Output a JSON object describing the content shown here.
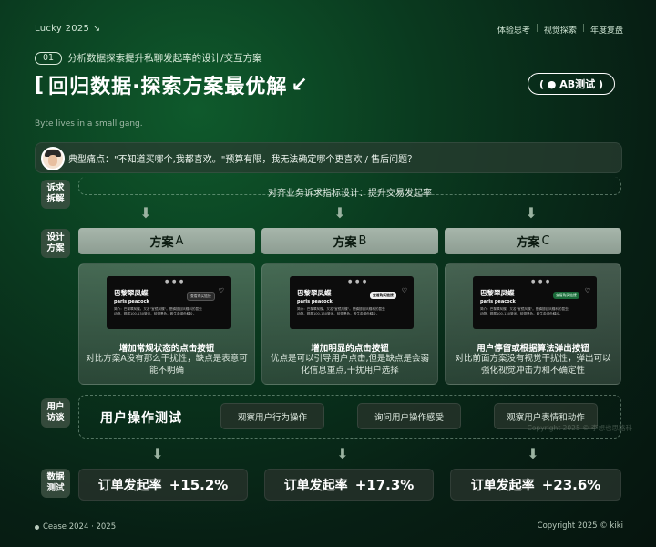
{
  "header": {
    "brand": "Lucky 2025 ↘",
    "nav": [
      "体验思考",
      "视觉探索",
      "年度复盘"
    ],
    "nav_sep": "|",
    "section_num": "01",
    "section_title": "分析数据探索提升私聊发起率的设计/交互方案",
    "title_main": "回归数据·探索方案最优解",
    "title_bracket_open": "[",
    "title_bracket_close": "↙",
    "ab_badge": "( ● AB测试 )",
    "tagline": "Byte lives in a small gang."
  },
  "pain_point": {
    "text": "典型痛点：\"不知道买哪个,我都喜欢。\"预算有限，我无法确定哪个更喜欢 / 售后问题？"
  },
  "rows": {
    "demand": {
      "label": "诉求\n拆解",
      "text": "对齐业务诉求指标设计：提升交易发起率"
    },
    "design": {
      "label": "设计\n方案"
    },
    "interview": {
      "label": "用户\n访谈"
    },
    "data": {
      "label": "数据\n测试"
    }
  },
  "plans": [
    {
      "head_prefix": "方案",
      "head_letter": "A",
      "title": "增加常规状态的点击按钮",
      "desc": "对比方案A没有那么干扰性，缺点是表意可能不明确",
      "mock": {
        "dots": "● ● ●",
        "name": "巴黎翠凤蝶",
        "sub": "paris peacock",
        "desc": "简介：巴黎翠凤蝶。又名\"宝镜凤蝶\"。是鳞翅目凤蝶科的昆虫动物。翅展100-130毫米。前翅黑色。散生金绿色鳞片。",
        "button": "查看购买链接",
        "heart": "♡"
      }
    },
    {
      "head_prefix": "方案",
      "head_letter": "B",
      "title": "增加明显的点击按钮",
      "desc": "优点是可以引导用户点击,但是缺点是会弱化信息重点,干扰用户选择",
      "mock": {
        "dots": "● ● ●",
        "name": "巴黎翠凤蝶",
        "sub": "paris peacock",
        "desc": "简介：巴黎翠凤蝶。又名\"宝镜凤蝶\"。是鳞翅目凤蝶科的昆虫动物。翅展100-130毫米。前翅黑色。散生金绿色鳞片。",
        "button": "查看购买链接",
        "heart": "♡"
      }
    },
    {
      "head_prefix": "方案",
      "head_letter": "C",
      "title": "用户停留或根据算法弹出按钮",
      "desc": "对比前面方案没有视觉干扰性，弹出可以强化视觉冲击力和不确定性",
      "mock": {
        "dots": "● ● ●",
        "name": "巴黎翠凤蝶",
        "sub": "paris peacock",
        "desc": "简介：巴黎翠凤蝶。又名\"宝镜凤蝶\"。是鳞翅目凤蝶科的昆虫动物。翅展100-130毫米。前翅黑色。散生金绿色鳞片。",
        "button": "查看购买链接",
        "heart": "♡"
      }
    }
  ],
  "user_test": {
    "title": "用户操作测试",
    "pills": [
      "观察用户行为操作",
      "询问用户操作感受",
      "观察用户表情和动作"
    ],
    "watermark": "Copyright 2025 © 李想也思路科"
  },
  "results": [
    {
      "label": "订单发起率",
      "value": "+15.2%"
    },
    {
      "label": "订单发起率",
      "value": "+17.3%"
    },
    {
      "label": "订单发起率",
      "value": "+23.6%"
    }
  ],
  "footer": {
    "left": "Cease 2024 · 2025",
    "right": "Copyright 2025 © kiki"
  },
  "colors": {
    "bg_dark": "#06140e",
    "bg_green": "#0f5a2c",
    "plan_head": "#a7b6ab",
    "text": "#ffffff"
  }
}
